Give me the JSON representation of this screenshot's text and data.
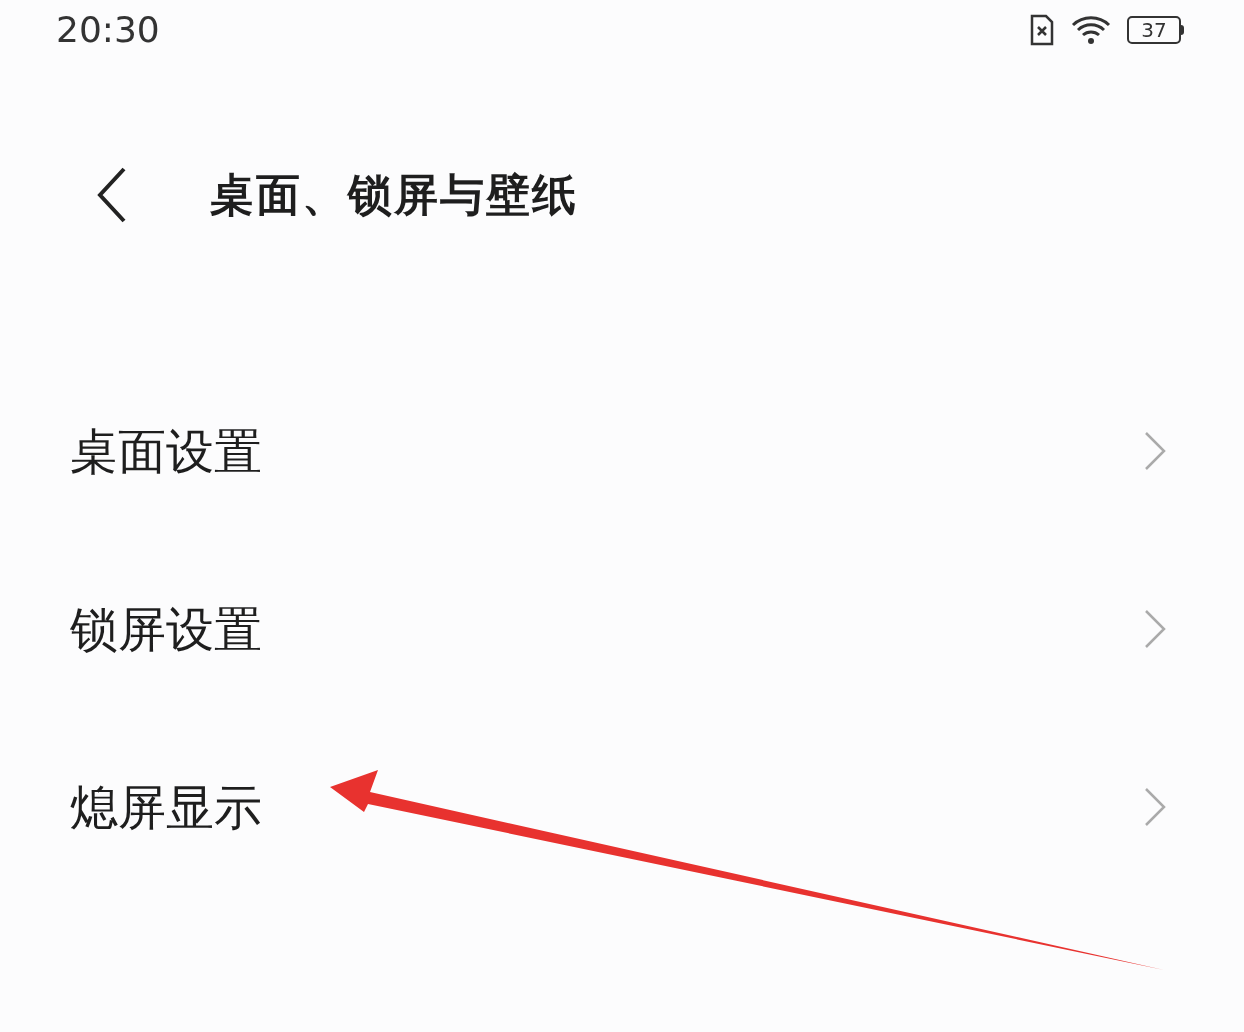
{
  "status_bar": {
    "time": "20:30",
    "battery": "37"
  },
  "header": {
    "title": "桌面、锁屏与壁纸"
  },
  "items": [
    {
      "label": "桌面设置"
    },
    {
      "label": "锁屏设置"
    },
    {
      "label": "熄屏显示"
    }
  ]
}
